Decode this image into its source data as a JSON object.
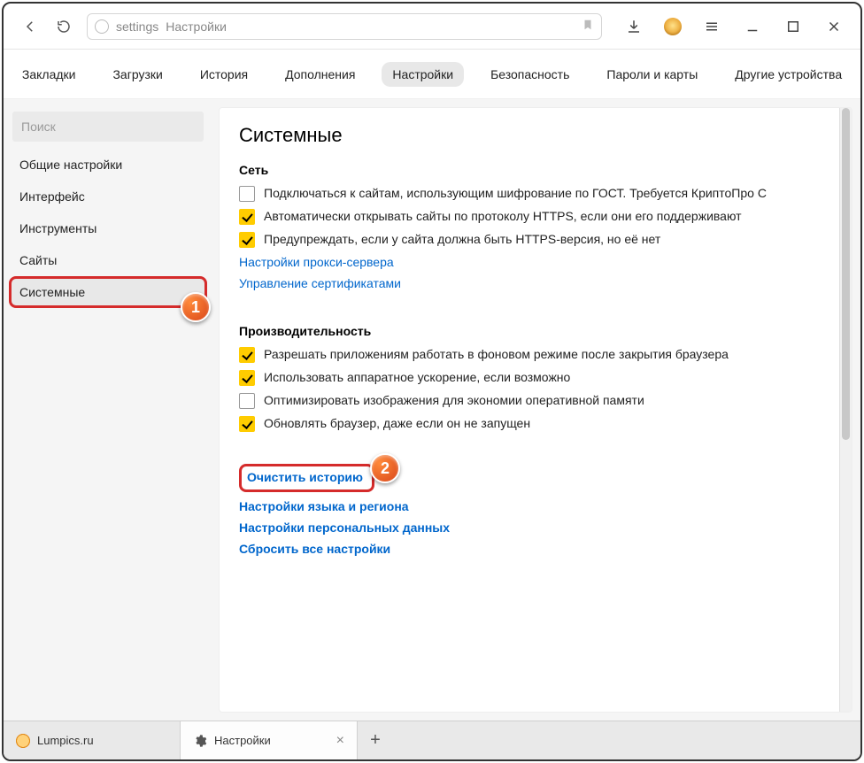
{
  "toolbar": {
    "address_seg1": "settings",
    "address_seg2": "Настройки"
  },
  "nav": {
    "items": [
      "Закладки",
      "Загрузки",
      "История",
      "Дополнения",
      "Настройки",
      "Безопасность",
      "Пароли и карты",
      "Другие устройства"
    ],
    "active_index": 4
  },
  "sidebar": {
    "search_placeholder": "Поиск",
    "items": [
      "Общие настройки",
      "Интерфейс",
      "Инструменты",
      "Сайты",
      "Системные"
    ],
    "active_index": 4
  },
  "content": {
    "title": "Системные",
    "section_network": "Сеть",
    "net_items": [
      {
        "checked": false,
        "label": "Подключаться к сайтам, использующим шифрование по ГОСТ. Требуется КриптоПро C"
      },
      {
        "checked": true,
        "label": "Автоматически открывать сайты по протоколу HTTPS, если они его поддерживают"
      },
      {
        "checked": true,
        "label": "Предупреждать, если у сайта должна быть HTTPS-версия, но её нет"
      }
    ],
    "net_links": [
      "Настройки прокси-сервера",
      "Управление сертификатами"
    ],
    "section_perf": "Производительность",
    "perf_items": [
      {
        "checked": true,
        "label": "Разрешать приложениям работать в фоновом режиме после закрытия браузера"
      },
      {
        "checked": true,
        "label": "Использовать аппаратное ускорение, если возможно"
      },
      {
        "checked": false,
        "label": "Оптимизировать изображения для экономии оперативной памяти"
      },
      {
        "checked": true,
        "label": "Обновлять браузер, даже если он не запущен"
      }
    ],
    "action_links": [
      "Очистить историю",
      "Настройки языка и региона",
      "Настройки персональных данных",
      "Сбросить все настройки"
    ]
  },
  "badges": {
    "one": "1",
    "two": "2"
  },
  "tabs": {
    "items": [
      {
        "label": "Lumpics.ru",
        "closable": false
      },
      {
        "label": "Настройки",
        "closable": true
      }
    ],
    "active_index": 1
  }
}
